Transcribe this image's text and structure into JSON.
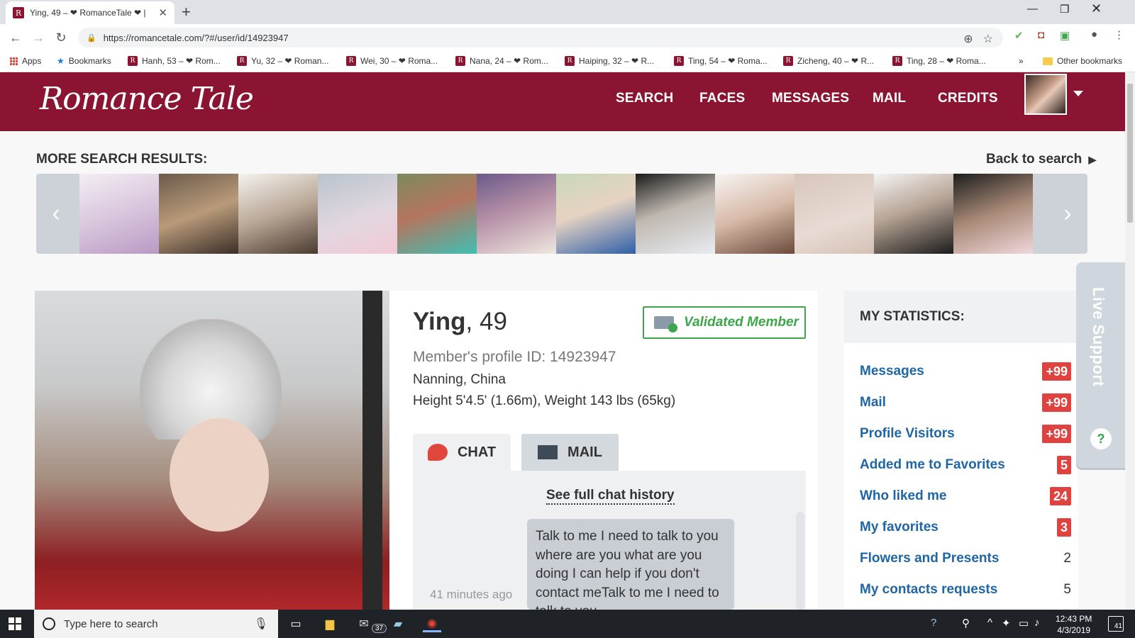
{
  "browser": {
    "tab_title": "Ying, 49 – ❤ RomanceTale ❤ |",
    "new_tab": "+",
    "url": "https://romancetale.com/?#/user/id/14923947",
    "bookmarks": [
      {
        "label": "Apps"
      },
      {
        "label": "Bookmarks"
      },
      {
        "label": "Hanh, 53 – ❤ Rom..."
      },
      {
        "label": "Yu, 32 – ❤ Roman..."
      },
      {
        "label": "Wei, 30 – ❤ Roma..."
      },
      {
        "label": "Nana, 24 – ❤ Rom..."
      },
      {
        "label": "Haiping, 32 – ❤ R..."
      },
      {
        "label": "Ting, 54 – ❤ Roma..."
      },
      {
        "label": "Zicheng, 40 – ❤ R..."
      },
      {
        "label": "Ting, 28 – ❤ Roma..."
      }
    ],
    "bookmarks_overflow": "»",
    "other_bookmarks": "Other bookmarks"
  },
  "site": {
    "logo": "Romance Tale",
    "nav": [
      {
        "label": "SEARCH"
      },
      {
        "label": "FACES"
      },
      {
        "label": "MESSAGES"
      },
      {
        "label": "MAIL"
      },
      {
        "label": "CREDITS"
      }
    ]
  },
  "search_results": {
    "heading": "MORE SEARCH RESULTS:",
    "back": "Back to search",
    "prev": "‹",
    "next": "›"
  },
  "profile": {
    "name": "Ying",
    "age": ", 49",
    "validated": "Validated Member",
    "profile_id": "Member's profile ID: 14923947",
    "location": "Nanning, China",
    "height_weight": "Height 5'4.5' (1.66m), Weight 143 lbs (65kg)",
    "tab_chat": "CHAT",
    "tab_mail": "MAIL",
    "full_history": "See full chat history",
    "message_text": "Talk to me I need to talk to you where are you what are you doing I can help if you don't contact meTalk to me I need to talk to you",
    "message_time": "41 minutes ago"
  },
  "statistics": {
    "heading": "MY STATISTICS:",
    "rows": [
      {
        "label": "Messages",
        "value": "+99"
      },
      {
        "label": "Mail",
        "value": "+99"
      },
      {
        "label": "Profile Visitors",
        "value": "+99"
      },
      {
        "label": "Added me to Favorites",
        "value": "5"
      },
      {
        "label": "Who liked me",
        "value": "24"
      },
      {
        "label": "My favorites",
        "value": "3"
      },
      {
        "label": "Flowers and Presents",
        "value": "2"
      },
      {
        "label": "My contacts requests",
        "value": "5"
      }
    ]
  },
  "live_support": {
    "label": "Live Support",
    "icon_glyph": "?"
  },
  "taskbar": {
    "search_placeholder": "Type here to search",
    "mail_badge": "37",
    "time": "12:43 PM",
    "date": "4/3/2019",
    "notifications": "41"
  },
  "colors": {
    "brand": "#8a1431",
    "link": "#1f66a6",
    "badge": "#e0433f",
    "validated": "#3da64a"
  }
}
